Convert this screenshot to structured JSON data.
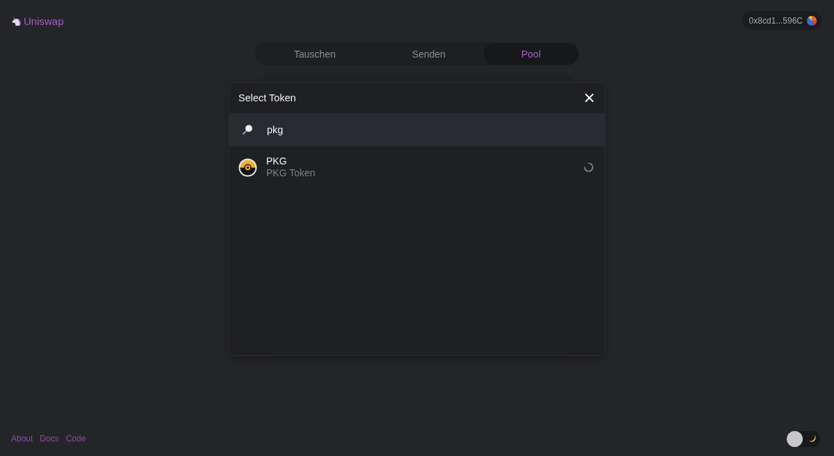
{
  "header": {
    "logo": {
      "text": "Uniswap"
    },
    "wallet": {
      "address": "0x8cd1...596C"
    }
  },
  "tabs": [
    {
      "label": "Tauschen",
      "selected": false
    },
    {
      "label": "Senden",
      "selected": false
    },
    {
      "label": "Pool",
      "selected": true
    }
  ],
  "token_modal": {
    "title": "Select Token",
    "search": {
      "value": "pkg"
    },
    "tokens": [
      {
        "symbol": "PKG",
        "name": "PKG Token",
        "loading": true
      }
    ]
  },
  "footer": {
    "links": [
      "About",
      "Docs",
      "Code"
    ]
  },
  "theme_toggle": {
    "dark_mode": true
  }
}
